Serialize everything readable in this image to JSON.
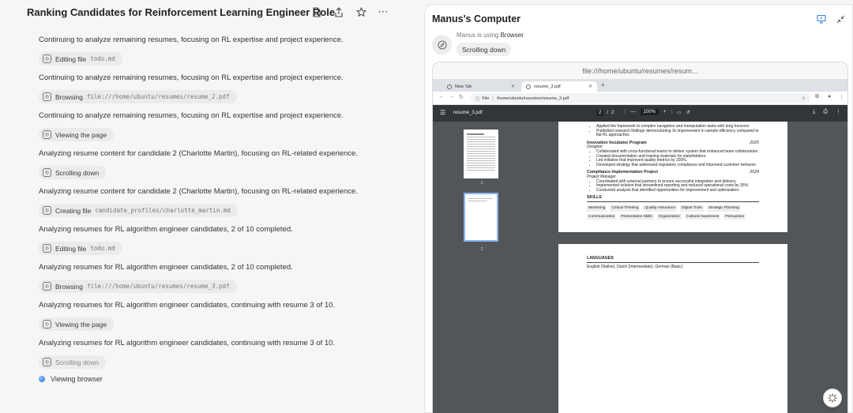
{
  "task": {
    "title": "Ranking Candidates for Reinforcement Learning Engineer Role",
    "header_icons": [
      "file-icon",
      "share-icon",
      "star-icon",
      "more-icon"
    ]
  },
  "timeline": [
    {
      "type": "message",
      "text": "Continuing to analyze remaining resumes, focusing on RL expertise and project experience."
    },
    {
      "type": "step",
      "action": "Editing file",
      "arg": "todo.md"
    },
    {
      "type": "message",
      "text": "Continuing to analyze remaining resumes, focusing on RL expertise and project experience."
    },
    {
      "type": "step",
      "action": "Browsing",
      "arg": "file:///home/ubuntu/resumes/resume_2.pdf"
    },
    {
      "type": "message",
      "text": "Continuing to analyze remaining resumes, focusing on RL expertise and project experience."
    },
    {
      "type": "step",
      "action": "Viewing the page",
      "arg": ""
    },
    {
      "type": "message",
      "text": "Analyzing resume content for candidate 2 (Charlotte Martin), focusing on RL-related experience."
    },
    {
      "type": "step",
      "action": "Scrolling down",
      "arg": ""
    },
    {
      "type": "message",
      "text": "Analyzing resume content for candidate 2 (Charlotte Martin), focusing on RL-related experience."
    },
    {
      "type": "step",
      "action": "Creating file",
      "arg": "candidate_profiles/charlotte_martin.md"
    },
    {
      "type": "message",
      "text": "Analyzing resumes for RL algorithm engineer candidates, 2 of 10 completed."
    },
    {
      "type": "step",
      "action": "Editing file",
      "arg": "todo.md"
    },
    {
      "type": "message",
      "text": "Analyzing resumes for RL algorithm engineer candidates, 2 of 10 completed."
    },
    {
      "type": "step",
      "action": "Browsing",
      "arg": "file:///home/ubuntu/resumes/resume_3.pdf"
    },
    {
      "type": "message",
      "text": "Analyzing resumes for RL algorithm engineer candidates, continuing with resume 3 of 10."
    },
    {
      "type": "step",
      "action": "Viewing the page",
      "arg": ""
    },
    {
      "type": "message",
      "text": "Analyzing resumes for RL algorithm engineer candidates, continuing with resume 3 of 10."
    },
    {
      "type": "step",
      "action": "Scrolling down",
      "arg": ""
    }
  ],
  "current_status": "Viewing browser",
  "computer": {
    "title": "Manus's Computer",
    "using_prefix": "Manus is using",
    "tool": "Browser",
    "action": "Scrolling down",
    "url_display": "file:///home/ubuntu/resumes/resum..."
  },
  "browser": {
    "tabs": [
      {
        "label": "New Tab",
        "active": false
      },
      {
        "label": "resume_3.pdf",
        "active": true
      }
    ],
    "omnibox_scheme": "File",
    "omnibox_path": "/home/ubuntu/resumes/resume_3.pdf",
    "pdf": {
      "filename": "resume_3.pdf",
      "page_current": "2",
      "page_total": "2",
      "zoom": "100%",
      "thumb_labels": [
        "1",
        "2"
      ]
    }
  },
  "resume": {
    "top_bullets": [
      "Applied the framework to complex navigation and manipulation tasks with long horizons",
      "Published research findings demonstrating 3x improvement in sample efficiency compared to",
      "flat RL approaches"
    ],
    "jobs": [
      {
        "org": "Innovation Incubator Program",
        "year": "2025",
        "role": "Designer",
        "bullets": [
          "Collaborated with cross-functional teams to deliver system that enhanced team collaboration.",
          "Created documentation and training materials for stakeholders.",
          "Led initiative that improved quality metrics by 100%.",
          "Developed strategy that addressed regulatory compliance and improved customer behavior."
        ]
      },
      {
        "org": "Compliance Implementation Project",
        "year": "2024",
        "role": "Project Manager",
        "bullets": [
          "Coordinated with external partners to ensure successful integration and delivery.",
          "Implemented solution that streamlined reporting and reduced operational costs by 35%.",
          "Conducted analysis that identified opportunities for improvement and optimization."
        ]
      }
    ],
    "skills_heading": "SKILLS",
    "skills": [
      "Mentoring",
      "Critical Thinking",
      "Quality Assurance",
      "Digital Tools",
      "Strategic Planning",
      "Communication",
      "Presentation Skills",
      "Organization",
      "Cultural Awareness",
      "Persuasion"
    ],
    "languages_heading": "LANGUAGES",
    "languages": "English (Native), Dutch (Intermediate), German (Basic)"
  }
}
